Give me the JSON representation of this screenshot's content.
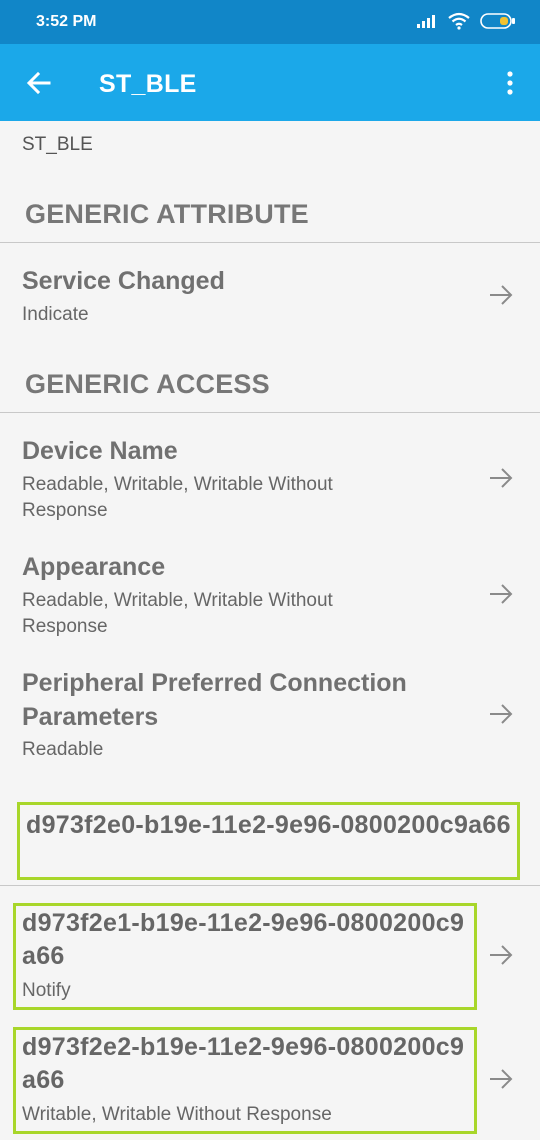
{
  "status_bar": {
    "time": "3:52 PM"
  },
  "app_bar": {
    "title": "ST_BLE"
  },
  "device_label": "ST_BLE",
  "services": [
    {
      "name": "GENERIC ATTRIBUTE",
      "characteristics": [
        {
          "name": "Service Changed",
          "properties": "Indicate"
        }
      ]
    },
    {
      "name": "GENERIC ACCESS",
      "characteristics": [
        {
          "name": "Device Name",
          "properties": "Readable, Writable, Writable Without Response"
        },
        {
          "name": "Appearance",
          "properties": "Readable, Writable, Writable Without Response"
        },
        {
          "name": "Peripheral Preferred Connection Parameters",
          "properties": "Readable"
        }
      ]
    },
    {
      "name": "d973f2e0-b19e-11e2-9e96-0800200c9a66",
      "characteristics": [
        {
          "name": "d973f2e1-b19e-11e2-9e96-0800200c9a66",
          "properties": "Notify"
        },
        {
          "name": "d973f2e2-b19e-11e2-9e96-0800200c9a66",
          "properties": "Writable, Writable Without Response"
        }
      ]
    }
  ],
  "colors": {
    "status_bar": "#1186c8",
    "app_bar": "#1ba8e9",
    "highlight": "#a8d62a"
  },
  "icons": {
    "back": "arrow-left-icon",
    "overflow": "more-vert-icon",
    "row_arrow": "arrow-right-icon"
  }
}
